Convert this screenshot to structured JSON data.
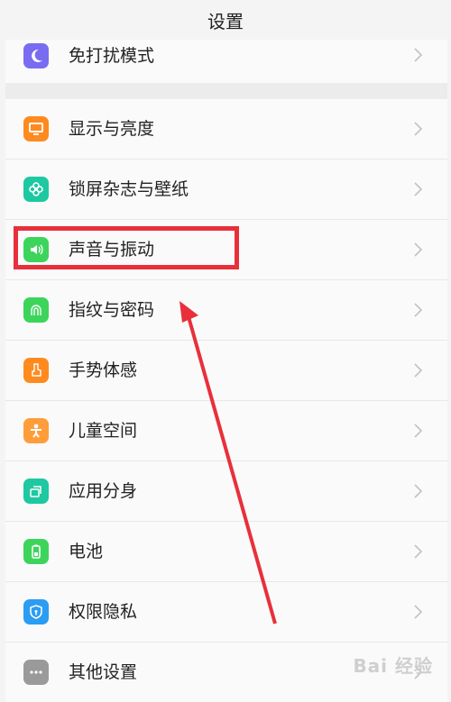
{
  "header": {
    "title": "设置"
  },
  "top_item": {
    "label": "免打扰模式",
    "icon": "moon-icon",
    "color": "#7a6cf0"
  },
  "items": [
    {
      "label": "显示与亮度",
      "icon": "monitor-icon",
      "color": "#ff8a1f"
    },
    {
      "label": "锁屏杂志与壁纸",
      "icon": "flower-icon",
      "color": "#1ec8a0"
    },
    {
      "label": "声音与振动",
      "icon": "speaker-icon",
      "color": "#3dd45c"
    },
    {
      "label": "指纹与密码",
      "icon": "fingerprint-icon",
      "color": "#3dd45c"
    },
    {
      "label": "手势体感",
      "icon": "hand-icon",
      "color": "#ff8a1f"
    },
    {
      "label": "儿童空间",
      "icon": "child-icon",
      "color": "#ff9d3a"
    },
    {
      "label": "应用分身",
      "icon": "app-clone-icon",
      "color": "#1ec8a0"
    },
    {
      "label": "电池",
      "icon": "battery-icon",
      "color": "#3dd45c"
    },
    {
      "label": "权限隐私",
      "icon": "shield-icon",
      "color": "#2b9df2"
    },
    {
      "label": "其他设置",
      "icon": "more-icon",
      "color": "#9a9a9a"
    }
  ],
  "annotation": {
    "highlight_color": "#e8303a"
  },
  "watermark": {
    "text": "Bai 经验"
  }
}
